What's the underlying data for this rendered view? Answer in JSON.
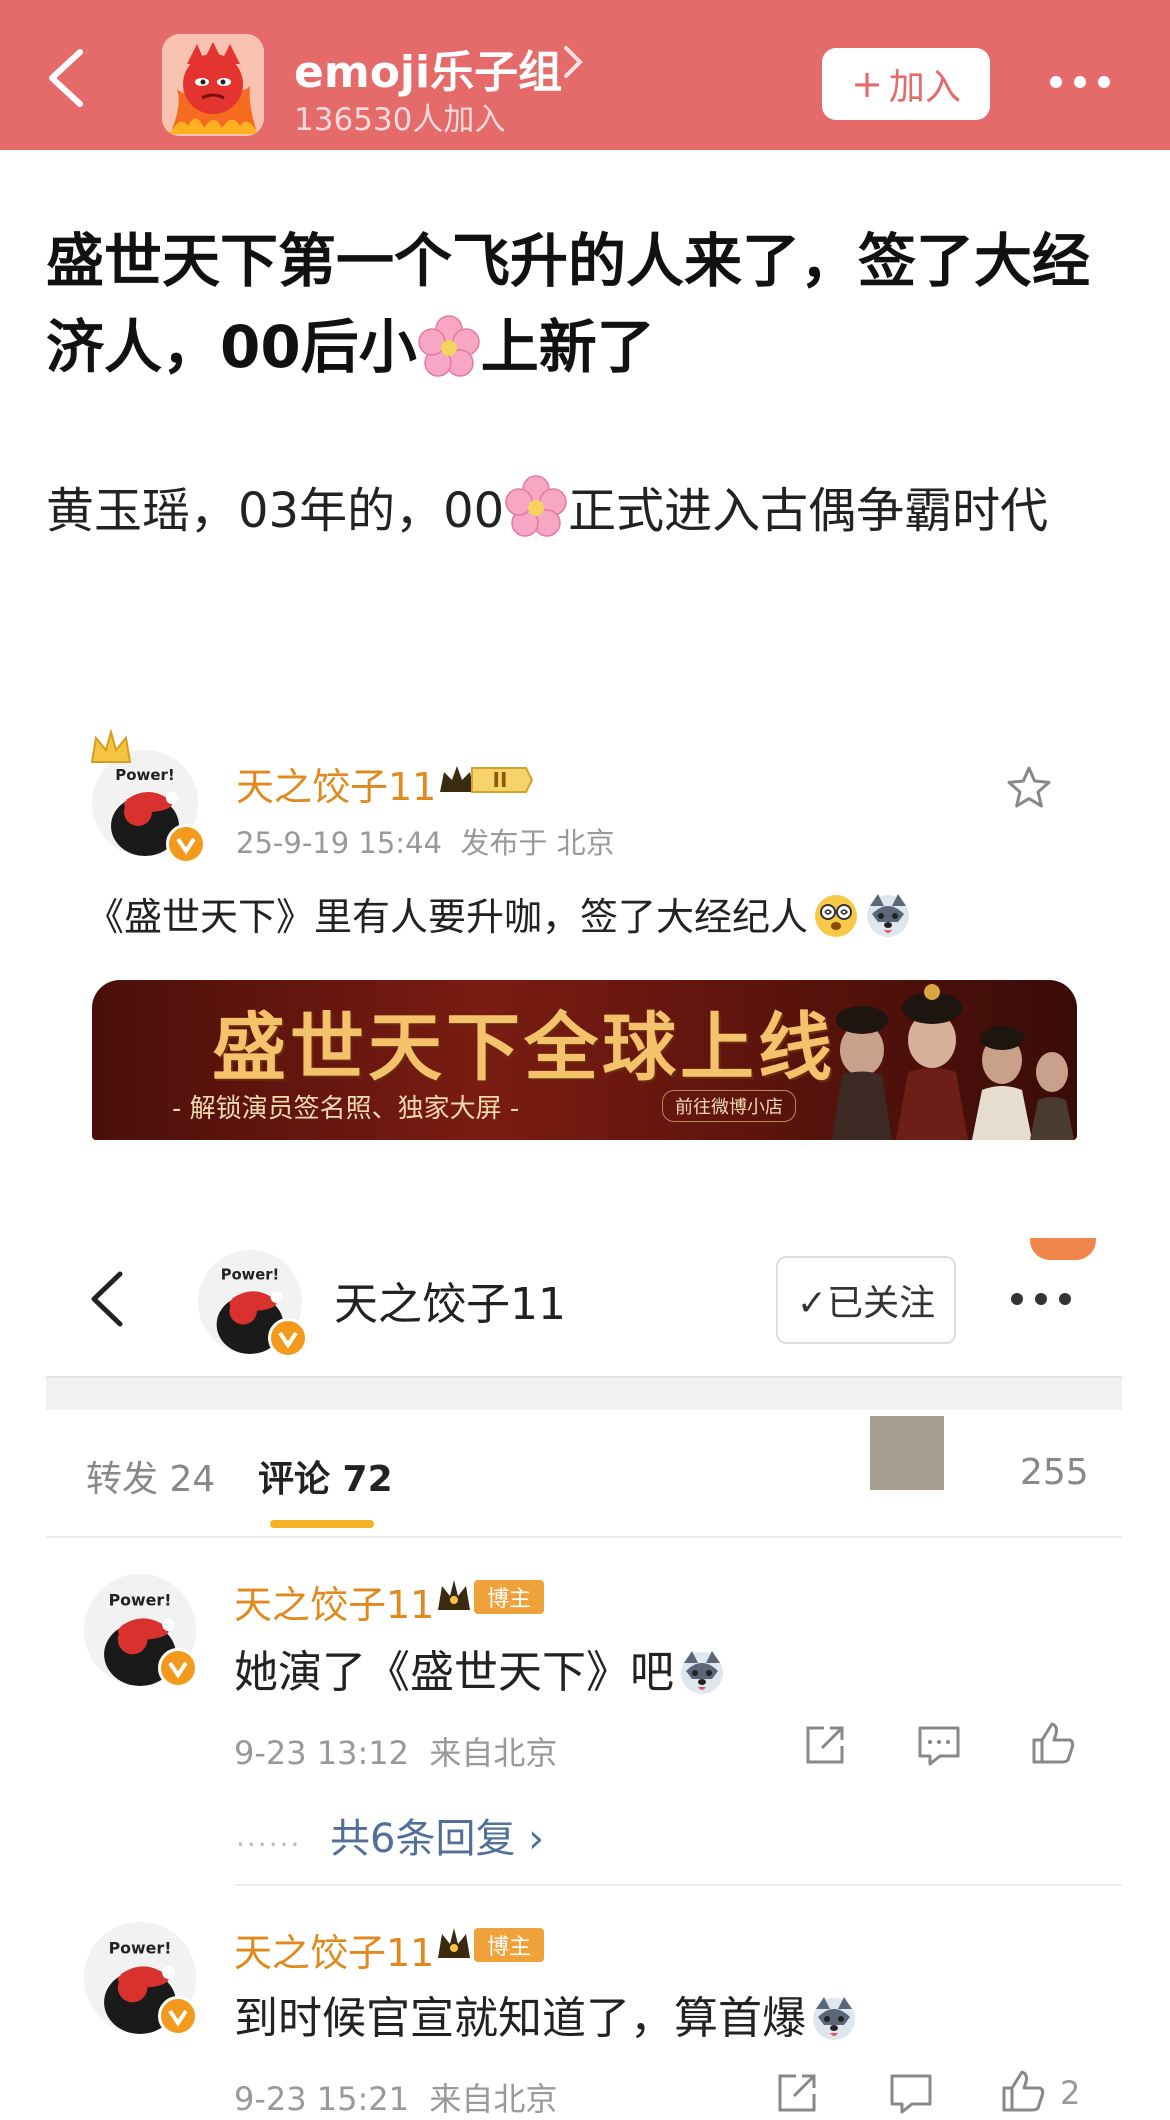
{
  "header": {
    "group_name": "emoji乐子组",
    "members": "136530人加入",
    "join_plus": "+",
    "join_label": "加入"
  },
  "post": {
    "title": "盛世天下第一个飞升的人来了，签了大经济人，00后小🌸上新了",
    "title_parts": [
      "盛世天下第一个飞升的人来了，签了大经济人，00后小",
      "上新了"
    ],
    "body_parts": [
      "黄玉瑶，03年的，00",
      "正式进入古偶争霸时代"
    ]
  },
  "card": {
    "author": "天之饺子11",
    "level": "II",
    "avatar_text": "Power!",
    "time": "25-9-19 15:44",
    "location": "发布于 北京",
    "text": "《盛世天下》里有人要升咖，签了大经纪人",
    "banner": {
      "title": "盛世天下全球上线",
      "subtitle": "- 解锁演员签名照、独家大屏 -",
      "shop": "前往微博小店"
    }
  },
  "profile": {
    "name": "天之饺子11",
    "follow_label": "✓已关注",
    "avatar_text": "Power!"
  },
  "tabs": {
    "repost": "转发 24",
    "comment": "评论 72",
    "likes": "255"
  },
  "comments": [
    {
      "author": "天之饺子11",
      "tag": "博主",
      "text": "她演了《盛世天下》吧",
      "time": "9-23 13:12",
      "location": "来自北京",
      "avatar_text": "Power!"
    },
    {
      "author": "天之饺子11",
      "tag": "博主",
      "text": "到时候官宣就知道了，算首爆",
      "time": "9-23 15:21",
      "location": "来自北京",
      "like_count": "2",
      "avatar_text": "Power!"
    }
  ],
  "replies": {
    "dots": "······",
    "label": "共6条回复 ›"
  },
  "colors": {
    "header_bg": "#e56a6a",
    "author": "#e08a1e",
    "link": "#50709a",
    "tab_underline": "#f3b325",
    "verify": "#f39a1d"
  },
  "icons": [
    "back-icon",
    "chevron-right-icon",
    "more-icon",
    "star-icon",
    "cherry-blossom-icon",
    "share-icon",
    "comment-icon",
    "like-icon",
    "verified-icon",
    "crown-icon"
  ]
}
